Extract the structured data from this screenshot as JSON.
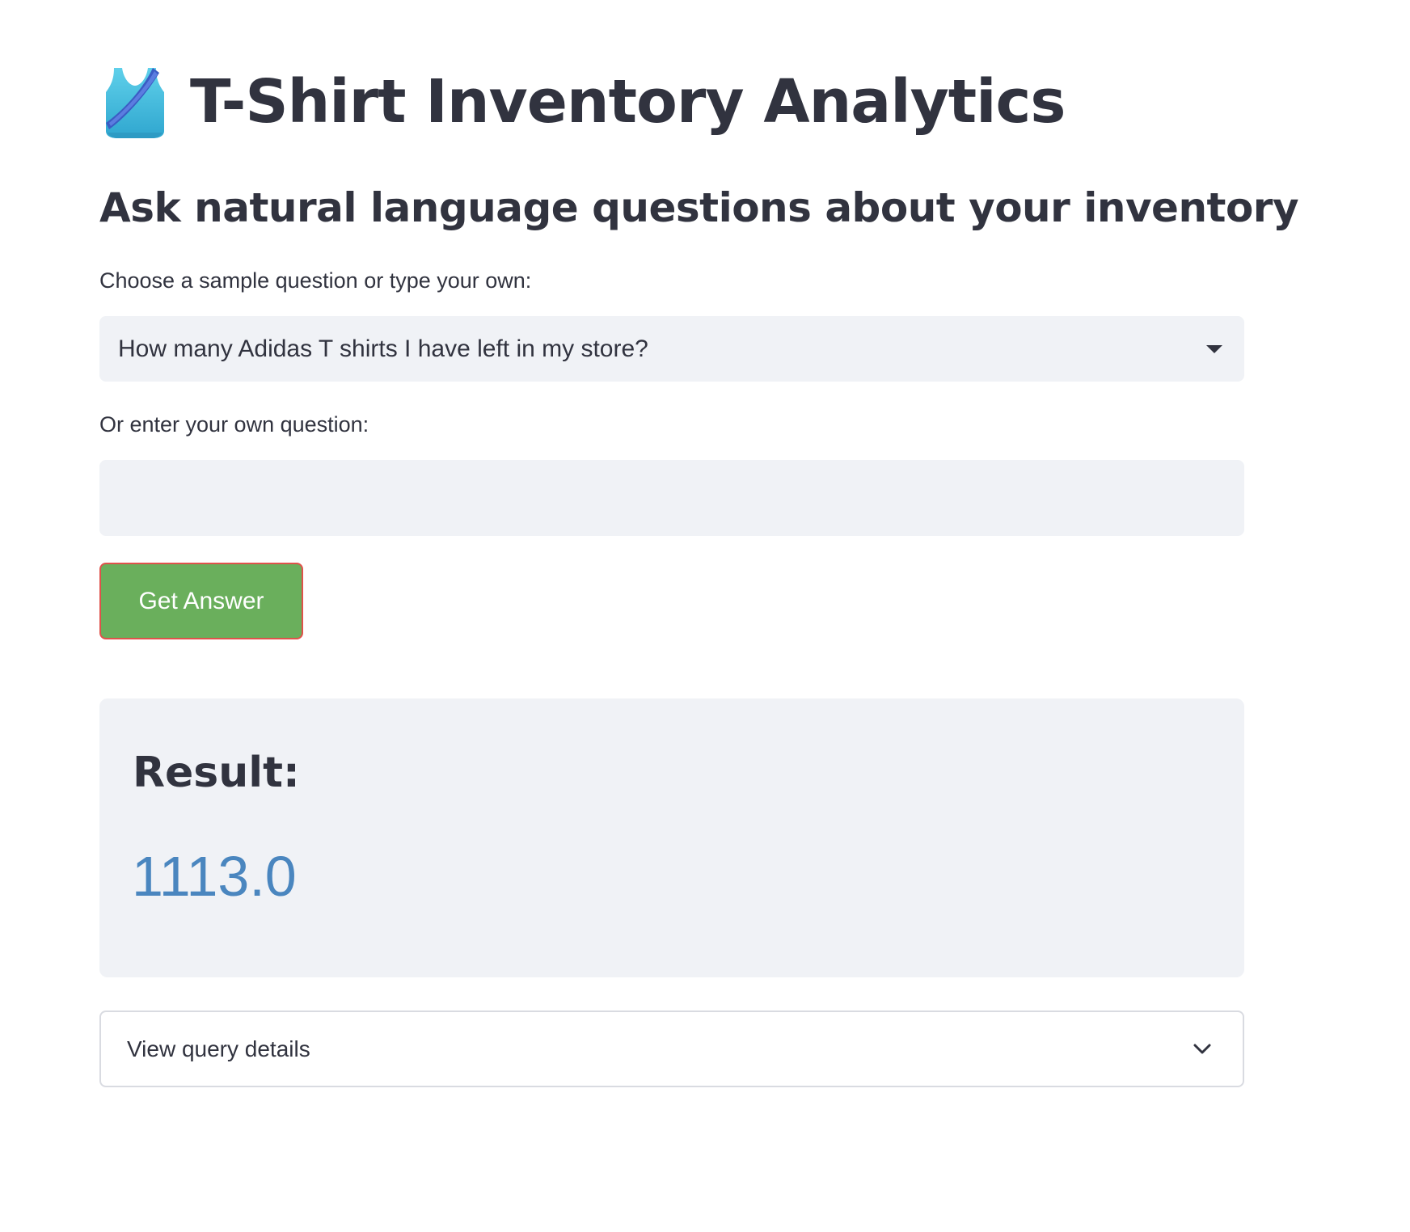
{
  "header": {
    "title": "T-Shirt Inventory Analytics",
    "title_icon": "tank-top-icon",
    "subtitle": "Ask natural language questions about your inventory"
  },
  "sample_question": {
    "label": "Choose a sample question or type your own:",
    "selected": "How many Adidas T shirts I have left in my store?",
    "icon": "caret-down-icon"
  },
  "custom_question": {
    "label": "Or enter your own question:",
    "value": "",
    "placeholder": ""
  },
  "actions": {
    "submit_label": "Get Answer"
  },
  "result": {
    "heading": "Result:",
    "value": "1113.0"
  },
  "details": {
    "label": "View query details",
    "icon": "chevron-down-icon"
  },
  "colors": {
    "text": "#31333f",
    "field_background": "#f0f2f6",
    "button_green": "#6aaf5c",
    "button_border": "#e0524b",
    "result_value": "#4a86bf",
    "expander_border": "#d9dbe1"
  }
}
